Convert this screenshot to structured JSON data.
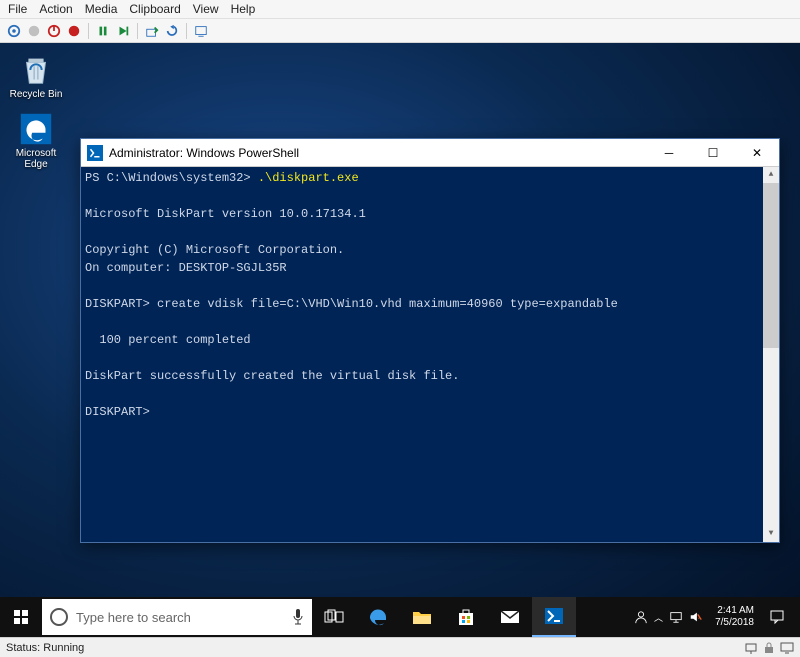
{
  "menu": {
    "items": [
      "File",
      "Action",
      "Media",
      "Clipboard",
      "View",
      "Help"
    ]
  },
  "desktop_icons": {
    "recycle": "Recycle Bin",
    "edge": "Microsoft Edge"
  },
  "powershell": {
    "title": "Administrator: Windows PowerShell",
    "lines": {
      "prompt1_pre": "PS C:\\Windows\\system32> ",
      "prompt1_cmd": ".\\diskpart.exe",
      "l2": "Microsoft DiskPart version 10.0.17134.1",
      "l3": "Copyright (C) Microsoft Corporation.",
      "l4": "On computer: DESKTOP-SGJL35R",
      "l5": "DISKPART> create vdisk file=C:\\VHD\\Win10.vhd maximum=40960 type=expandable",
      "l6": "  100 percent completed",
      "l7": "DiskPart successfully created the virtual disk file.",
      "l8": "DISKPART>"
    }
  },
  "taskbar": {
    "search_placeholder": "Type here to search",
    "time": "2:41 AM",
    "date": "7/5/2018"
  },
  "status": {
    "label": "Status: Running"
  }
}
